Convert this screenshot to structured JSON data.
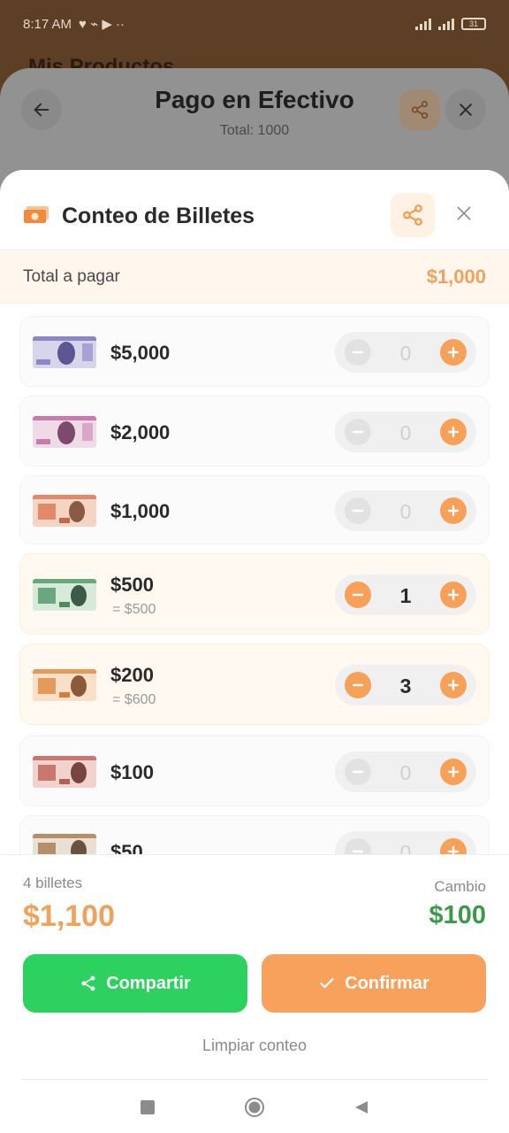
{
  "status_bar": {
    "time": "8:17 AM",
    "battery": "31"
  },
  "background_page": {
    "title": "Mis Productos"
  },
  "cash_payment": {
    "title": "Pago en Efectivo",
    "total_line": "Total: 1000"
  },
  "bill_count": {
    "title": "Conteo de Billetes",
    "total_label": "Total a pagar",
    "total_value": "$1,000",
    "bills": [
      {
        "label": "$5,000",
        "subtotal": "",
        "count": "0",
        "active": false,
        "note_color": "#8d86c4"
      },
      {
        "label": "$2,000",
        "subtotal": "",
        "count": "0",
        "active": false,
        "note_color": "#c77bb0"
      },
      {
        "label": "$1,000",
        "subtotal": "",
        "count": "0",
        "active": false,
        "note_color": "#e2896a"
      },
      {
        "label": "$500",
        "subtotal": "= $500",
        "count": "1",
        "active": true,
        "note_color": "#6aa77c"
      },
      {
        "label": "$200",
        "subtotal": "= $600",
        "count": "3",
        "active": true,
        "note_color": "#e59a5a"
      },
      {
        "label": "$100",
        "subtotal": "",
        "count": "0",
        "active": false,
        "note_color": "#c9776f"
      },
      {
        "label": "$50",
        "subtotal": "",
        "count": "0",
        "active": false,
        "note_color": "#b58e6a"
      }
    ]
  },
  "footer": {
    "bill_count_text": "4 billetes",
    "sum": "$1,100",
    "change_label": "Cambio",
    "change_value": "$100",
    "share_button": "Compartir",
    "confirm_button": "Confirmar",
    "clear_link": "Limpiar conteo"
  },
  "colors": {
    "accent": "#f8a15d",
    "green": "#2dd15f",
    "change_green": "#3a9a49"
  }
}
